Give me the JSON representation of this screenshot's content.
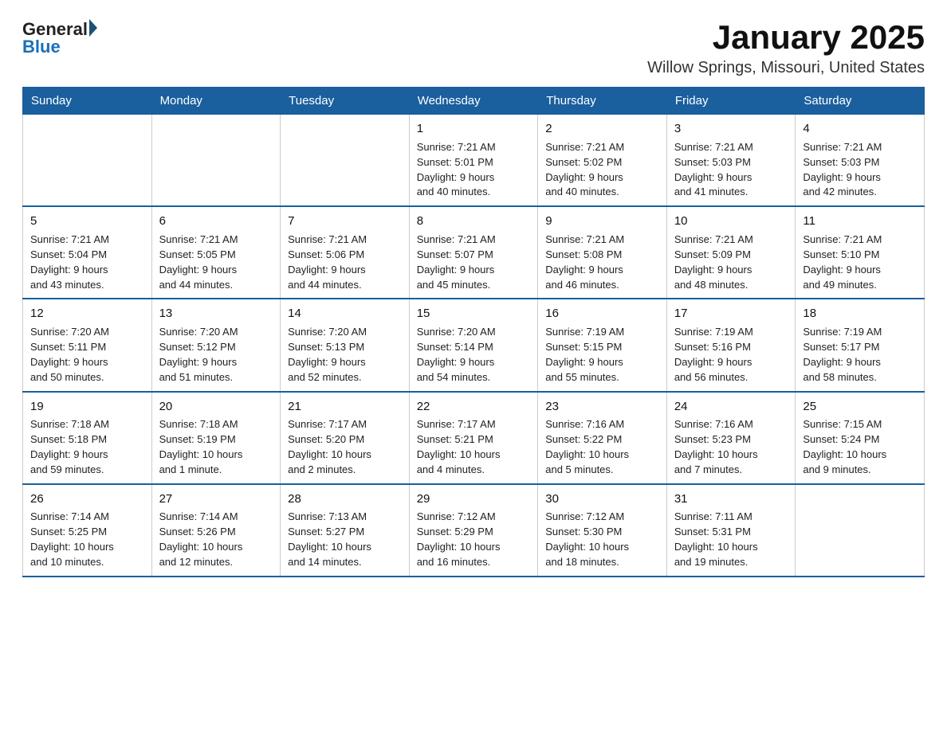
{
  "logo": {
    "text_general": "General",
    "text_blue": "Blue"
  },
  "title": "January 2025",
  "subtitle": "Willow Springs, Missouri, United States",
  "weekdays": [
    "Sunday",
    "Monday",
    "Tuesday",
    "Wednesday",
    "Thursday",
    "Friday",
    "Saturday"
  ],
  "weeks": [
    [
      {
        "day": "",
        "info": ""
      },
      {
        "day": "",
        "info": ""
      },
      {
        "day": "",
        "info": ""
      },
      {
        "day": "1",
        "info": "Sunrise: 7:21 AM\nSunset: 5:01 PM\nDaylight: 9 hours\nand 40 minutes."
      },
      {
        "day": "2",
        "info": "Sunrise: 7:21 AM\nSunset: 5:02 PM\nDaylight: 9 hours\nand 40 minutes."
      },
      {
        "day": "3",
        "info": "Sunrise: 7:21 AM\nSunset: 5:03 PM\nDaylight: 9 hours\nand 41 minutes."
      },
      {
        "day": "4",
        "info": "Sunrise: 7:21 AM\nSunset: 5:03 PM\nDaylight: 9 hours\nand 42 minutes."
      }
    ],
    [
      {
        "day": "5",
        "info": "Sunrise: 7:21 AM\nSunset: 5:04 PM\nDaylight: 9 hours\nand 43 minutes."
      },
      {
        "day": "6",
        "info": "Sunrise: 7:21 AM\nSunset: 5:05 PM\nDaylight: 9 hours\nand 44 minutes."
      },
      {
        "day": "7",
        "info": "Sunrise: 7:21 AM\nSunset: 5:06 PM\nDaylight: 9 hours\nand 44 minutes."
      },
      {
        "day": "8",
        "info": "Sunrise: 7:21 AM\nSunset: 5:07 PM\nDaylight: 9 hours\nand 45 minutes."
      },
      {
        "day": "9",
        "info": "Sunrise: 7:21 AM\nSunset: 5:08 PM\nDaylight: 9 hours\nand 46 minutes."
      },
      {
        "day": "10",
        "info": "Sunrise: 7:21 AM\nSunset: 5:09 PM\nDaylight: 9 hours\nand 48 minutes."
      },
      {
        "day": "11",
        "info": "Sunrise: 7:21 AM\nSunset: 5:10 PM\nDaylight: 9 hours\nand 49 minutes."
      }
    ],
    [
      {
        "day": "12",
        "info": "Sunrise: 7:20 AM\nSunset: 5:11 PM\nDaylight: 9 hours\nand 50 minutes."
      },
      {
        "day": "13",
        "info": "Sunrise: 7:20 AM\nSunset: 5:12 PM\nDaylight: 9 hours\nand 51 minutes."
      },
      {
        "day": "14",
        "info": "Sunrise: 7:20 AM\nSunset: 5:13 PM\nDaylight: 9 hours\nand 52 minutes."
      },
      {
        "day": "15",
        "info": "Sunrise: 7:20 AM\nSunset: 5:14 PM\nDaylight: 9 hours\nand 54 minutes."
      },
      {
        "day": "16",
        "info": "Sunrise: 7:19 AM\nSunset: 5:15 PM\nDaylight: 9 hours\nand 55 minutes."
      },
      {
        "day": "17",
        "info": "Sunrise: 7:19 AM\nSunset: 5:16 PM\nDaylight: 9 hours\nand 56 minutes."
      },
      {
        "day": "18",
        "info": "Sunrise: 7:19 AM\nSunset: 5:17 PM\nDaylight: 9 hours\nand 58 minutes."
      }
    ],
    [
      {
        "day": "19",
        "info": "Sunrise: 7:18 AM\nSunset: 5:18 PM\nDaylight: 9 hours\nand 59 minutes."
      },
      {
        "day": "20",
        "info": "Sunrise: 7:18 AM\nSunset: 5:19 PM\nDaylight: 10 hours\nand 1 minute."
      },
      {
        "day": "21",
        "info": "Sunrise: 7:17 AM\nSunset: 5:20 PM\nDaylight: 10 hours\nand 2 minutes."
      },
      {
        "day": "22",
        "info": "Sunrise: 7:17 AM\nSunset: 5:21 PM\nDaylight: 10 hours\nand 4 minutes."
      },
      {
        "day": "23",
        "info": "Sunrise: 7:16 AM\nSunset: 5:22 PM\nDaylight: 10 hours\nand 5 minutes."
      },
      {
        "day": "24",
        "info": "Sunrise: 7:16 AM\nSunset: 5:23 PM\nDaylight: 10 hours\nand 7 minutes."
      },
      {
        "day": "25",
        "info": "Sunrise: 7:15 AM\nSunset: 5:24 PM\nDaylight: 10 hours\nand 9 minutes."
      }
    ],
    [
      {
        "day": "26",
        "info": "Sunrise: 7:14 AM\nSunset: 5:25 PM\nDaylight: 10 hours\nand 10 minutes."
      },
      {
        "day": "27",
        "info": "Sunrise: 7:14 AM\nSunset: 5:26 PM\nDaylight: 10 hours\nand 12 minutes."
      },
      {
        "day": "28",
        "info": "Sunrise: 7:13 AM\nSunset: 5:27 PM\nDaylight: 10 hours\nand 14 minutes."
      },
      {
        "day": "29",
        "info": "Sunrise: 7:12 AM\nSunset: 5:29 PM\nDaylight: 10 hours\nand 16 minutes."
      },
      {
        "day": "30",
        "info": "Sunrise: 7:12 AM\nSunset: 5:30 PM\nDaylight: 10 hours\nand 18 minutes."
      },
      {
        "day": "31",
        "info": "Sunrise: 7:11 AM\nSunset: 5:31 PM\nDaylight: 10 hours\nand 19 minutes."
      },
      {
        "day": "",
        "info": ""
      }
    ]
  ]
}
